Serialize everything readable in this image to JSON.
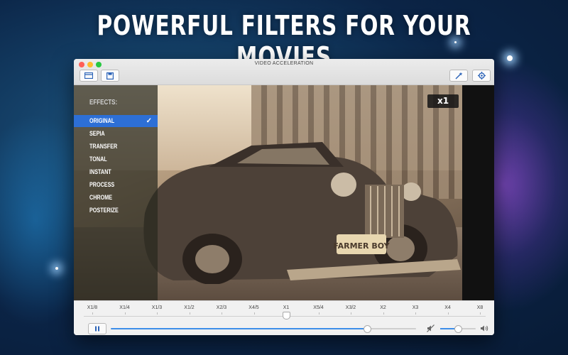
{
  "headline": "POWERFUL FILTERS FOR YOUR MOVIES",
  "window": {
    "title": "VIDEO ACCELERATION",
    "traffic_colors": [
      "#ff5f57",
      "#febc2e",
      "#28c840"
    ]
  },
  "toolbar": {
    "left_icons": [
      "open-icon",
      "save-icon"
    ],
    "right_icons": [
      "magic-wand-icon",
      "gear-icon"
    ]
  },
  "effects": {
    "label": "EFFECTS:",
    "items": [
      "ORIGINAL",
      "SEPIA",
      "TRANSFER",
      "TONAL",
      "INSTANT",
      "PROCESS",
      "CHROME",
      "POSTERIZE"
    ],
    "selected": "ORIGINAL",
    "check": "✓"
  },
  "viewer": {
    "speed_badge": "x1"
  },
  "speed_slider": {
    "labels": [
      "X1/8",
      "X1/4",
      "X1/3",
      "X1/2",
      "X2/3",
      "X4/5",
      "X1",
      "X5/4",
      "X3/2",
      "X2",
      "X3",
      "X4",
      "X8"
    ],
    "selected": "X1"
  },
  "playback": {
    "state": "paused",
    "progress_fraction": 0.84,
    "volume_fraction": 0.5
  },
  "colors": {
    "accent": "#3d8ee9",
    "selection": "#2d6fd6"
  }
}
